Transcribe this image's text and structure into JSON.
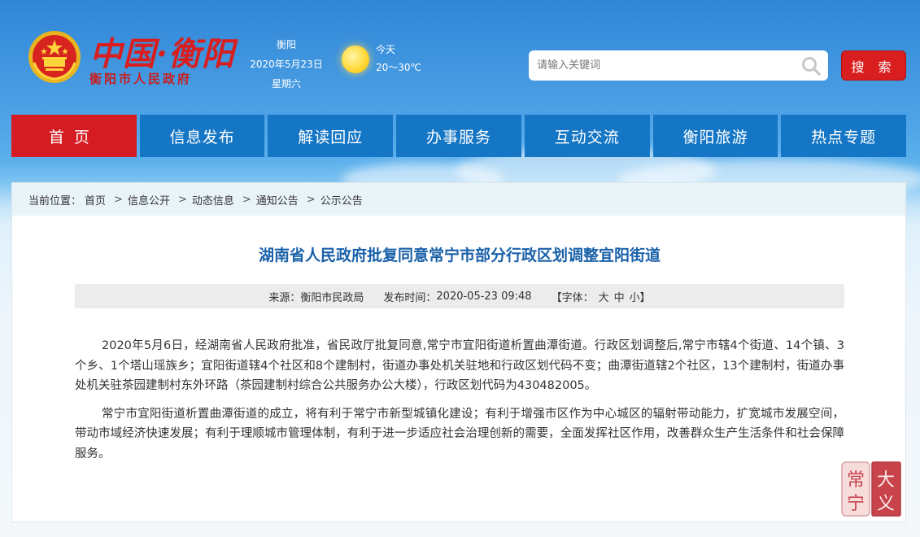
{
  "header": {
    "brand_title": "中国·衡阳",
    "brand_subtitle": "衡阳市人民政府",
    "city": "衡阳",
    "date": "2020年5月23日",
    "weekday": "星期六",
    "weather_label": "今天",
    "weather_temp": "20～30℃"
  },
  "search": {
    "placeholder": "请输入关键词",
    "button_label": "搜 索"
  },
  "nav": {
    "items": [
      "首页",
      "信息发布",
      "解读回应",
      "办事服务",
      "互动交流",
      "衡阳旅游",
      "热点专题"
    ],
    "active_index": 0
  },
  "breadcrumb": {
    "prefix": "当前位置：",
    "items": [
      "首页",
      "信息公开",
      "动态信息",
      "通知公告",
      "公示公告"
    ],
    "separator": ">"
  },
  "article": {
    "title": "湖南省人民政府批复同意常宁市部分行政区划调整宜阳街道",
    "source_label": "来源：",
    "source": "衡阳市民政局",
    "time_label": "发布时间：",
    "time": "2020-05-23 09:48",
    "font_label": "【字体：",
    "font_large": "大",
    "font_medium": "中",
    "font_small": "小",
    "font_close": "】",
    "paragraphs": [
      "2020年5月6日，经湖南省人民政府批准，省民政厅批复同意,常宁市宜阳街道析置曲潭街道。行政区划调整后,常宁市辖4个街道、14个镇、3个乡、1个塔山瑶族乡；宜阳街道辖4个社区和8个建制村，街道办事处机关驻地和行政区划代码不变；曲潭街道辖2个社区，13个建制村，街道办事处机关驻茶园建制村东外环路（茶园建制村综合公共服务办公大楼），行政区划代码为430482005。",
      "常宁市宜阳街道析置曲潭街道的成立，将有利于常宁市新型城镇化建设；有利于增强市区作为中心城区的辐射带动能力，扩宽城市发展空间，带动市域经济快速发展；有利于理顺城市管理体制，有利于进一步适应社会治理创新的需要，全面发挥社区作用，改善群众生产生活条件和社会保障服务。"
    ]
  },
  "seal": {
    "chars": [
      "常",
      "宁",
      "大",
      "义"
    ]
  },
  "colors": {
    "brand_red": "#d81e1e",
    "nav_blue": "#1476c4",
    "title_blue": "#1a61a9"
  }
}
